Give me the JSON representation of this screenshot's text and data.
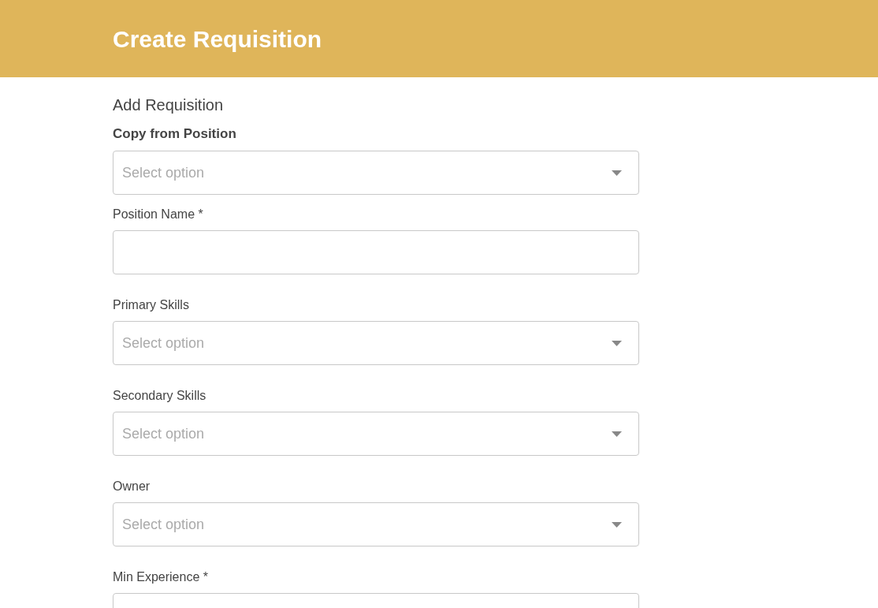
{
  "header": {
    "title": "Create Requisition"
  },
  "section_title": "Add Requisition",
  "fields": [
    {
      "label": "Copy from Position",
      "bold": true,
      "kind": "select",
      "placeholder": "Select option"
    },
    {
      "label": "Position Name *",
      "bold": false,
      "kind": "input"
    },
    {
      "label": "Primary Skills",
      "bold": false,
      "kind": "select",
      "placeholder": "Select option"
    },
    {
      "label": "Secondary Skills",
      "bold": false,
      "kind": "select",
      "placeholder": "Select option"
    },
    {
      "label": "Owner",
      "bold": false,
      "kind": "select",
      "placeholder": "Select option"
    },
    {
      "label": "Min Experience *",
      "bold": false,
      "kind": "input"
    }
  ]
}
